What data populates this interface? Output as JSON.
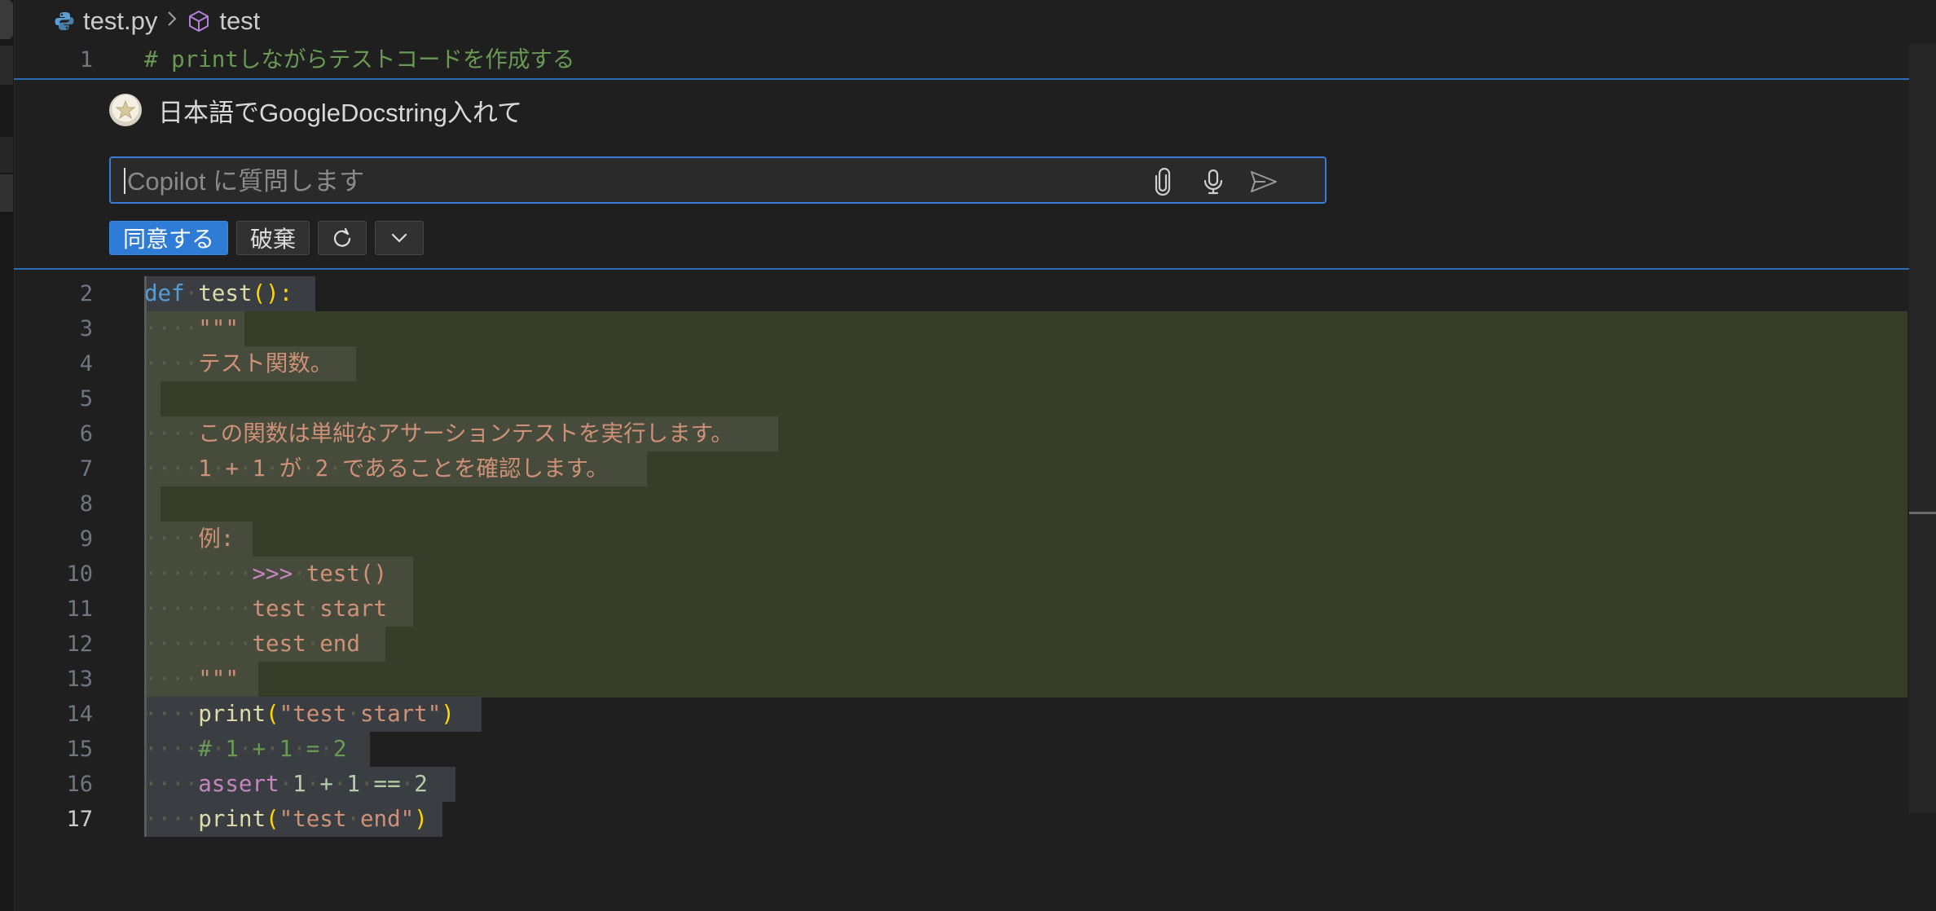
{
  "breadcrumb": {
    "file": "test.py",
    "symbol": "test"
  },
  "editor": {
    "active_line": 17,
    "line1": {
      "number": "1",
      "text": "# printしながらテストコードを作成する"
    },
    "lines": [
      {
        "number": "2"
      },
      {
        "number": "3"
      },
      {
        "number": "4"
      },
      {
        "number": "5"
      },
      {
        "number": "6"
      },
      {
        "number": "7"
      },
      {
        "number": "8"
      },
      {
        "number": "9"
      },
      {
        "number": "10"
      },
      {
        "number": "11"
      },
      {
        "number": "12"
      },
      {
        "number": "13"
      },
      {
        "number": "14"
      },
      {
        "number": "15"
      },
      {
        "number": "16"
      },
      {
        "number": "17"
      }
    ],
    "code": {
      "l2_kw": "def",
      "l2_fn": "test",
      "l2_rest": "():",
      "l3": "\"\"\"",
      "l4": "テスト関数。",
      "l6": "この関数は単純なアサーションテストを実行します。",
      "l7": "1 + 1 が 2 であることを確認します。",
      "l9": "例:",
      "l10_prompt": ">>>",
      "l10_rest": "test()",
      "l11": "test start",
      "l12": "test end",
      "l13": "\"\"\"",
      "l14_fn": "print",
      "l14_str": "\"test start\"",
      "l15": "# 1 + 1 = 2",
      "l16_kw": "assert",
      "l16_rest": "1 + 1 == 2",
      "l17_fn": "print",
      "l17_str": "\"test end\""
    }
  },
  "inline_chat": {
    "prompt": "日本語でGoogleDocstring入れて",
    "input_placeholder": "Copilot に質問します",
    "accept_label": "同意する",
    "discard_label": "破棄"
  },
  "icons": {
    "breadcrumb_file": "python-icon",
    "breadcrumb_symbol": "cube-icon",
    "attach": "paperclip-icon",
    "mic": "microphone-icon",
    "send": "send-icon",
    "regenerate": "refresh-icon",
    "more": "chevron-down-icon"
  },
  "colors": {
    "accent": "#2f7cd6",
    "added_bg": "#373d29"
  }
}
